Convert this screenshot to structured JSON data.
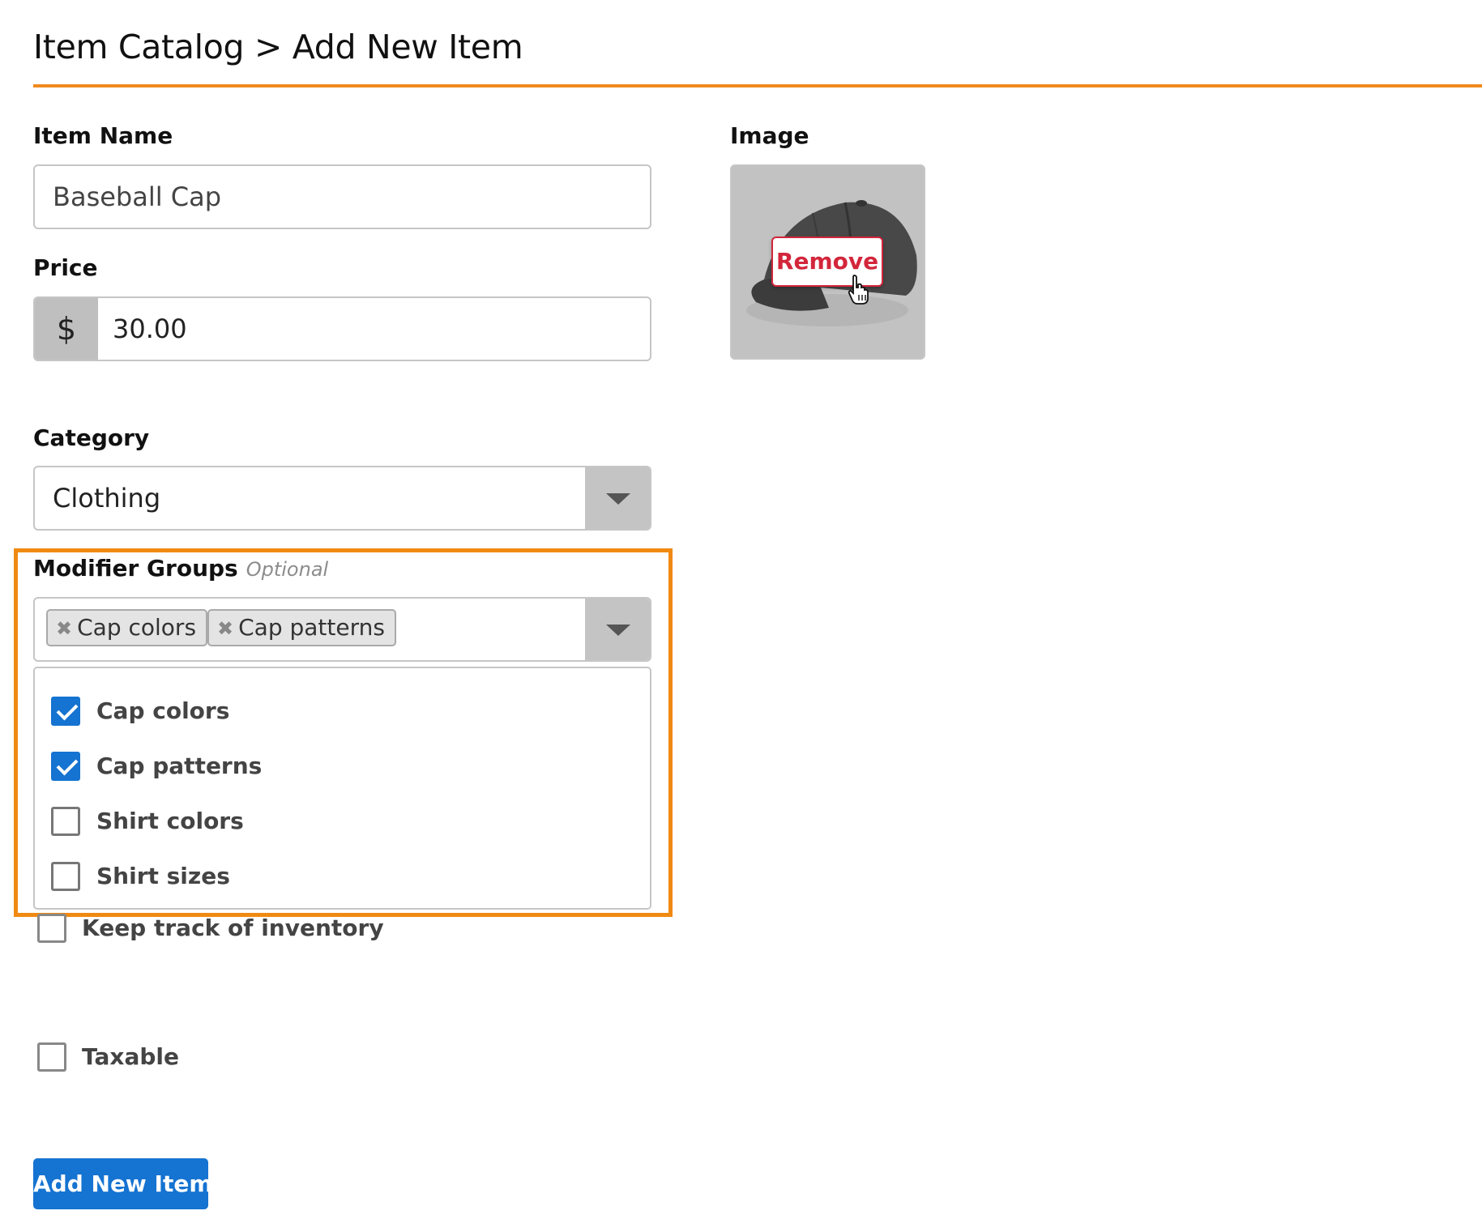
{
  "header": {
    "breadcrumb_parent": "Item Catalog",
    "separator": ">",
    "breadcrumb_current": "Add New Item"
  },
  "item_name": {
    "label": "Item Name",
    "value": "Baseball Cap"
  },
  "price": {
    "label": "Price",
    "currency_symbol": "$",
    "value": "30.00"
  },
  "image": {
    "label": "Image",
    "remove_label": "Remove"
  },
  "category": {
    "label": "Category",
    "selected": "Clothing"
  },
  "modifier_groups": {
    "label": "Modifier Groups",
    "optional_label": "Optional",
    "selected_chips": [
      "Cap colors",
      "Cap patterns"
    ],
    "options": [
      {
        "label": "Cap colors",
        "checked": true
      },
      {
        "label": "Cap patterns",
        "checked": true
      },
      {
        "label": "Shirt colors",
        "checked": false
      },
      {
        "label": "Shirt sizes",
        "checked": false
      }
    ]
  },
  "inventory": {
    "label": "Keep track of inventory",
    "checked": false
  },
  "taxable": {
    "label": "Taxable",
    "checked": false
  },
  "submit": {
    "label": "Add New Item"
  },
  "colors": {
    "accent_orange": "#ef8a1f",
    "primary_blue": "#1573d1",
    "danger_red": "#d3263b"
  },
  "icons": {
    "caret": "chevron-down-icon",
    "chip_remove": "close-icon",
    "cursor": "pointer-hand-icon"
  }
}
